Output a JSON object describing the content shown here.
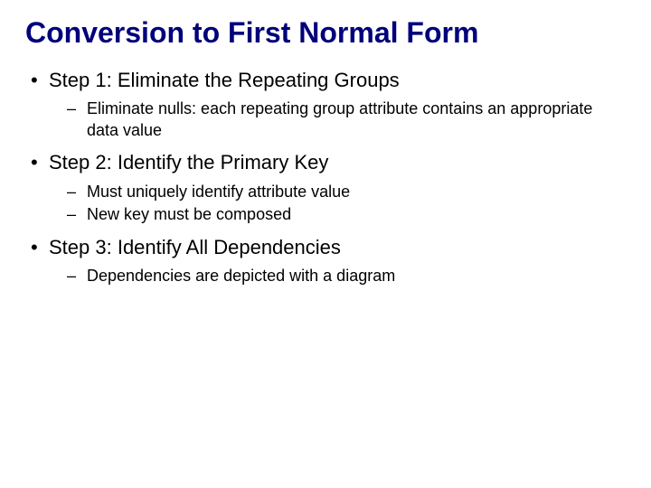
{
  "title": "Conversion to First Normal Form",
  "bullets": [
    {
      "text": "Step 1: Eliminate the Repeating Groups",
      "subs": [
        "Eliminate nulls: each repeating group attribute contains an appropriate data value"
      ]
    },
    {
      "text": "Step 2: Identify the Primary Key",
      "subs": [
        "Must uniquely identify attribute value",
        "New key must be composed"
      ]
    },
    {
      "text": "Step 3: Identify All Dependencies",
      "subs": [
        "Dependencies are depicted with a diagram"
      ]
    }
  ]
}
